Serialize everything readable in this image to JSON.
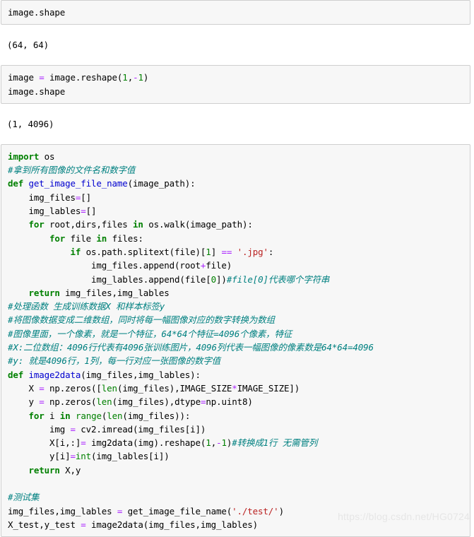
{
  "notebook": {
    "cells": [
      {
        "kind": "input",
        "name": "code-cell-1",
        "lines": [
          [
            {
              "t": "image.shape",
              "c": "plain"
            }
          ]
        ]
      },
      {
        "kind": "output",
        "name": "output-cell-1",
        "text": "(64, 64)"
      },
      {
        "kind": "input",
        "name": "code-cell-2",
        "lines": [
          [
            {
              "t": "image ",
              "c": "plain"
            },
            {
              "t": "=",
              "c": "o"
            },
            {
              "t": " image.reshape(",
              "c": "plain"
            },
            {
              "t": "1",
              "c": "n"
            },
            {
              "t": ",",
              "c": "plain"
            },
            {
              "t": "-",
              "c": "o"
            },
            {
              "t": "1",
              "c": "n"
            },
            {
              "t": ")",
              "c": "plain"
            }
          ],
          [
            {
              "t": "image.shape",
              "c": "plain"
            }
          ]
        ]
      },
      {
        "kind": "output",
        "name": "output-cell-2",
        "text": "(1, 4096)"
      },
      {
        "kind": "input",
        "name": "code-cell-3",
        "lines": [
          [
            {
              "t": "import",
              "c": "k"
            },
            {
              "t": " os",
              "c": "plain"
            }
          ],
          [
            {
              "t": "#拿到所有图像的文件名和数字值",
              "c": "c"
            }
          ],
          [
            {
              "t": "def",
              "c": "k"
            },
            {
              "t": " ",
              "c": "plain"
            },
            {
              "t": "get_image_file_name",
              "c": "fn"
            },
            {
              "t": "(image_path):",
              "c": "plain"
            }
          ],
          [
            {
              "t": "    img_files",
              "c": "plain"
            },
            {
              "t": "=",
              "c": "o"
            },
            {
              "t": "[]",
              "c": "plain"
            }
          ],
          [
            {
              "t": "    img_lables",
              "c": "plain"
            },
            {
              "t": "=",
              "c": "o"
            },
            {
              "t": "[]",
              "c": "plain"
            }
          ],
          [
            {
              "t": "    ",
              "c": "plain"
            },
            {
              "t": "for",
              "c": "k"
            },
            {
              "t": " root,dirs,files ",
              "c": "plain"
            },
            {
              "t": "in",
              "c": "k"
            },
            {
              "t": " os.walk(image_path):",
              "c": "plain"
            }
          ],
          [
            {
              "t": "        ",
              "c": "plain"
            },
            {
              "t": "for",
              "c": "k"
            },
            {
              "t": " file ",
              "c": "plain"
            },
            {
              "t": "in",
              "c": "k"
            },
            {
              "t": " files:",
              "c": "plain"
            }
          ],
          [
            {
              "t": "            ",
              "c": "plain"
            },
            {
              "t": "if",
              "c": "k"
            },
            {
              "t": " os.path.splitext(file)[",
              "c": "plain"
            },
            {
              "t": "1",
              "c": "n"
            },
            {
              "t": "] ",
              "c": "plain"
            },
            {
              "t": "==",
              "c": "o"
            },
            {
              "t": " ",
              "c": "plain"
            },
            {
              "t": "'.jpg'",
              "c": "s"
            },
            {
              "t": ":",
              "c": "plain"
            }
          ],
          [
            {
              "t": "                img_files.append(root",
              "c": "plain"
            },
            {
              "t": "+",
              "c": "o"
            },
            {
              "t": "file)",
              "c": "plain"
            }
          ],
          [
            {
              "t": "                img_lables.append(file[",
              "c": "plain"
            },
            {
              "t": "0",
              "c": "n"
            },
            {
              "t": "])",
              "c": "plain"
            },
            {
              "t": "#file[0]代表哪个字符串",
              "c": "c"
            }
          ],
          [
            {
              "t": "    ",
              "c": "plain"
            },
            {
              "t": "return",
              "c": "k"
            },
            {
              "t": " img_files,img_lables",
              "c": "plain"
            }
          ],
          [
            {
              "t": "#处理函数 生成训练数据X 和样本标签y",
              "c": "c"
            }
          ],
          [
            {
              "t": "#将图像数据变成二维数组，同时将每一幅图像对应的数字转换为数组",
              "c": "c"
            }
          ],
          [
            {
              "t": "#图像里面，一个像素，就是一个特征，64*64个特征=4096个像素，特征",
              "c": "c"
            }
          ],
          [
            {
              "t": "#X:二位数组：4096行代表有4096张训练图片，4096列代表一幅图像的像素数是64*64=4096",
              "c": "c"
            }
          ],
          [
            {
              "t": "#y: 就是4096行，1列，每一行对应一张图像的数字值",
              "c": "c"
            }
          ],
          [
            {
              "t": "def",
              "c": "k"
            },
            {
              "t": " ",
              "c": "plain"
            },
            {
              "t": "image2data",
              "c": "fn"
            },
            {
              "t": "(img_files,img_lables):",
              "c": "plain"
            }
          ],
          [
            {
              "t": "    X ",
              "c": "plain"
            },
            {
              "t": "=",
              "c": "o"
            },
            {
              "t": " np.zeros([",
              "c": "plain"
            },
            {
              "t": "len",
              "c": "bi"
            },
            {
              "t": "(img_files),IMAGE_SIZE",
              "c": "plain"
            },
            {
              "t": "*",
              "c": "o"
            },
            {
              "t": "IMAGE_SIZE])",
              "c": "plain"
            }
          ],
          [
            {
              "t": "    y ",
              "c": "plain"
            },
            {
              "t": "=",
              "c": "o"
            },
            {
              "t": " np.zeros(",
              "c": "plain"
            },
            {
              "t": "len",
              "c": "bi"
            },
            {
              "t": "(img_files),dtype",
              "c": "plain"
            },
            {
              "t": "=",
              "c": "o"
            },
            {
              "t": "np.uint8)",
              "c": "plain"
            }
          ],
          [
            {
              "t": "    ",
              "c": "plain"
            },
            {
              "t": "for",
              "c": "k"
            },
            {
              "t": " i ",
              "c": "plain"
            },
            {
              "t": "in",
              "c": "k"
            },
            {
              "t": " ",
              "c": "plain"
            },
            {
              "t": "range",
              "c": "bi"
            },
            {
              "t": "(",
              "c": "plain"
            },
            {
              "t": "len",
              "c": "bi"
            },
            {
              "t": "(img_files)):",
              "c": "plain"
            }
          ],
          [
            {
              "t": "        img ",
              "c": "plain"
            },
            {
              "t": "=",
              "c": "o"
            },
            {
              "t": " cv2.imread(img_files[i])",
              "c": "plain"
            }
          ],
          [
            {
              "t": "        X[i,:]",
              "c": "plain"
            },
            {
              "t": "=",
              "c": "o"
            },
            {
              "t": " img2data(img).reshape(",
              "c": "plain"
            },
            {
              "t": "1",
              "c": "n"
            },
            {
              "t": ",",
              "c": "plain"
            },
            {
              "t": "-",
              "c": "o"
            },
            {
              "t": "1",
              "c": "n"
            },
            {
              "t": ")",
              "c": "plain"
            },
            {
              "t": "#转换成1行 无需管列",
              "c": "c"
            }
          ],
          [
            {
              "t": "        y[i]",
              "c": "plain"
            },
            {
              "t": "=",
              "c": "o"
            },
            {
              "t": "int",
              "c": "bi"
            },
            {
              "t": "(img_lables[i])",
              "c": "plain"
            }
          ],
          [
            {
              "t": "    ",
              "c": "plain"
            },
            {
              "t": "return",
              "c": "k"
            },
            {
              "t": " X,y",
              "c": "plain"
            }
          ],
          [
            {
              "t": "",
              "c": "plain"
            }
          ],
          [
            {
              "t": "#测试集",
              "c": "c"
            }
          ],
          [
            {
              "t": "img_files,img_lables ",
              "c": "plain"
            },
            {
              "t": "=",
              "c": "o"
            },
            {
              "t": " get_image_file_name(",
              "c": "plain"
            },
            {
              "t": "'./test/'",
              "c": "s"
            },
            {
              "t": ")",
              "c": "plain"
            }
          ],
          [
            {
              "t": "X_test,y_test ",
              "c": "plain"
            },
            {
              "t": "=",
              "c": "o"
            },
            {
              "t": " image2data(img_files,img_lables)",
              "c": "plain"
            }
          ]
        ]
      }
    ]
  },
  "watermark": {
    "text": "https://blog.csdn.net/HG0724"
  },
  "colors": {
    "cell_background": "#f7f7f7",
    "cell_border": "#cfcfcf",
    "keyword": "#008000",
    "function_name": "#0000cf",
    "builtin": "#008000",
    "number": "#008000",
    "string": "#ba2121",
    "operator": "#aa22ff",
    "comment": "#008080",
    "text": "#000000",
    "watermark": "#e6e6e6"
  }
}
